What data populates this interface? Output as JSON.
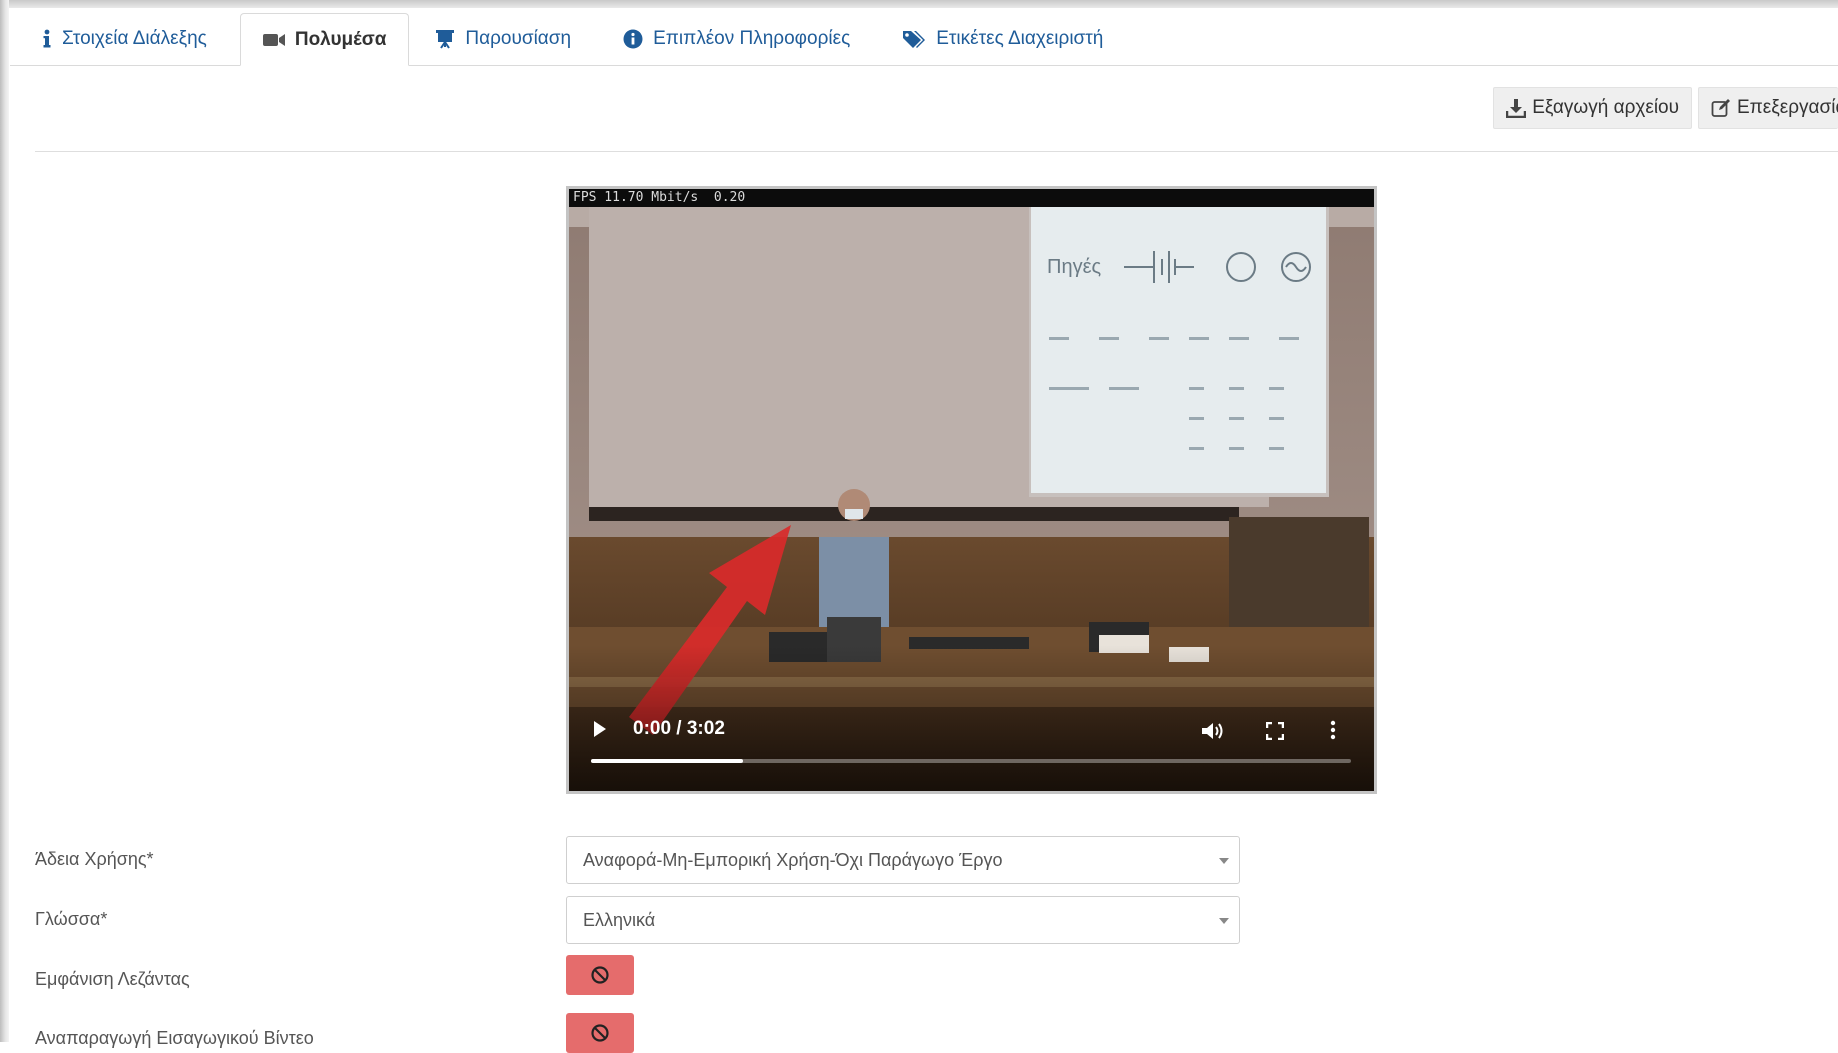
{
  "tabs": [
    {
      "label": "Στοιχεία Διάλεξης",
      "icon": "info-icon",
      "active": false
    },
    {
      "label": "Πολυμέσα",
      "icon": "video-camera-icon",
      "active": true
    },
    {
      "label": "Παρουσίαση",
      "icon": "presentation-board-icon",
      "active": false
    },
    {
      "label": "Επιπλέον Πληροφορίες",
      "icon": "info-circle-icon",
      "active": false
    },
    {
      "label": "Ετικέτες Διαχειριστή",
      "icon": "tags-icon",
      "active": false
    }
  ],
  "toolbar": {
    "export_label": "Εξαγωγή αρχείου",
    "edit_label": "Επεξεργασία"
  },
  "video": {
    "overlay_text": "FPS 11.70 Mbit/s  0.20",
    "time": "0:00 / 3:02",
    "progress_fraction": 0.2
  },
  "form": {
    "license": {
      "label": "Άδεια Χρήσης*",
      "value": "Αναφορά-Μη-Εμπορική Χρήση-Όχι Παράγωγο Έργο"
    },
    "language": {
      "label": "Γλώσσα*",
      "value": "Ελληνικά"
    },
    "captions": {
      "label": "Εμφάνιση Λεζάντας",
      "state": "off"
    },
    "intro_video": {
      "label": "Αναπαραγωγή Εισαγωγικού Βίντεο",
      "state": "off"
    }
  },
  "colors": {
    "link": "#1f5c99",
    "toggle_off": "#e56c6c",
    "arrow": "#d92a2a"
  }
}
